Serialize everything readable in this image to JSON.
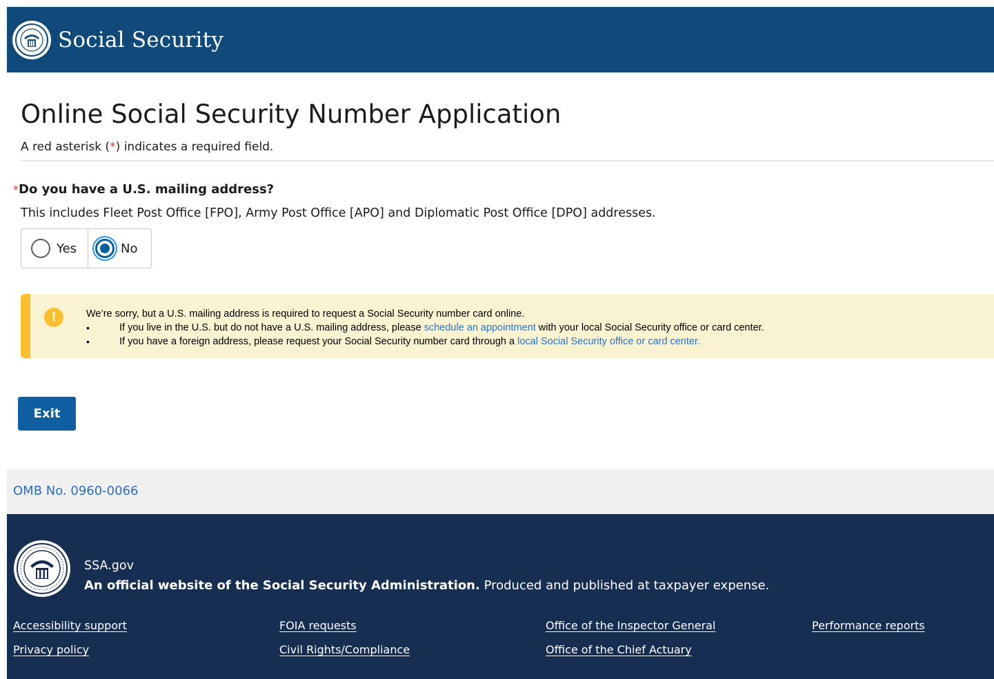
{
  "header": {
    "brand": "Social Security",
    "seal_icon": "ssa-seal-icon"
  },
  "main": {
    "title": "Online Social Security Number Application",
    "required_note_prefix": "A red asterisk (",
    "required_note_star": "*",
    "required_note_suffix": ") indicates a required field.",
    "question": {
      "required_mark": "*",
      "text": "Do you have a U.S. mailing address?",
      "hint": "This includes Fleet Post Office [FPO], Army Post Office [APO] and Diplomatic Post Office [DPO] addresses.",
      "options": [
        {
          "label": "Yes",
          "selected": false
        },
        {
          "label": "No",
          "selected": true
        }
      ]
    },
    "alert": {
      "icon": "exclamation-icon",
      "icon_glyph": "!",
      "intro": "We’re sorry, but a U.S. mailing address is required to request a Social Security number card online.",
      "bullet1_before": "If you live in the U.S. but do not have a U.S. mailing address, please ",
      "bullet1_link": "schedule an appointment",
      "bullet1_after": " with your local Social Security office or card center.",
      "bullet2_before": "If you have a foreign address, please request your Social Security number card through a ",
      "bullet2_link": "local Social Security office or card center."
    },
    "exit_label": "Exit"
  },
  "omb": {
    "label": "OMB No. 0960-0066"
  },
  "footer": {
    "site": "SSA.gov",
    "official_bold": "An official website of the Social Security Administration.",
    "official_rest": " Produced and published at taxpayer expense.",
    "links": {
      "accessibility": "Accessibility support",
      "privacy": "Privacy policy",
      "foia": "FOIA requests",
      "civil_rights": "Civil Rights/Compliance",
      "inspector": "Office of the Inspector General",
      "actuary": "Office of the Chief Actuary",
      "performance": "Performance reports"
    }
  },
  "colors": {
    "header_bg": "#0f4a7b",
    "footer_bg": "#162e51",
    "primary_button": "#0f5ea2",
    "required_red": "#d83933",
    "alert_bg": "#faf3d1",
    "alert_accent": "#ffbe2e",
    "link_blue": "#2b74c7"
  }
}
